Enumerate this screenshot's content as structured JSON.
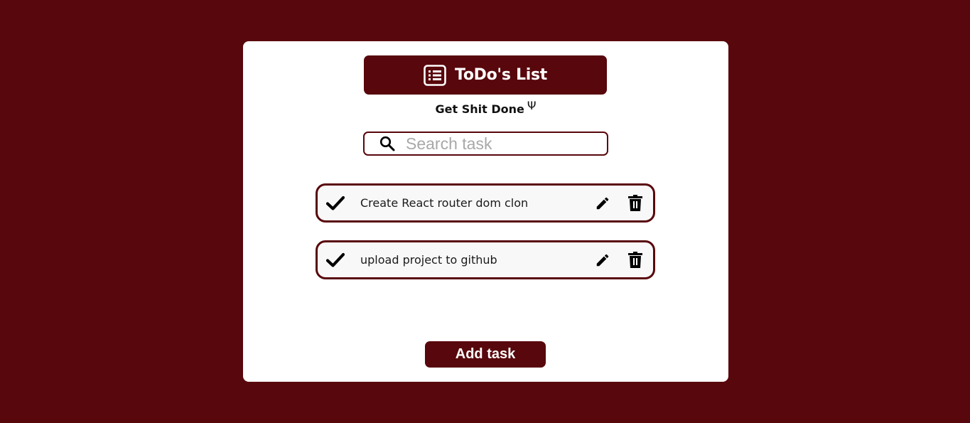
{
  "header": {
    "title": "ToDo's List",
    "icon": "list-icon"
  },
  "subtitle": {
    "text": "Get Shit Done",
    "symbol": "Ψ"
  },
  "search": {
    "placeholder": "Search task",
    "value": "",
    "icon": "search-icon"
  },
  "tasks": [
    {
      "text": "Create React router dom clon",
      "check_icon": "check-icon",
      "edit_icon": "pencil-icon",
      "delete_icon": "trash-icon"
    },
    {
      "text": "upload project to github",
      "check_icon": "check-icon",
      "edit_icon": "pencil-icon",
      "delete_icon": "trash-icon"
    }
  ],
  "actions": {
    "add_label": "Add task"
  },
  "colors": {
    "background": "#58070c",
    "card": "#ffffff",
    "accent": "#58070c",
    "task_bg": "#f8f8f8"
  }
}
